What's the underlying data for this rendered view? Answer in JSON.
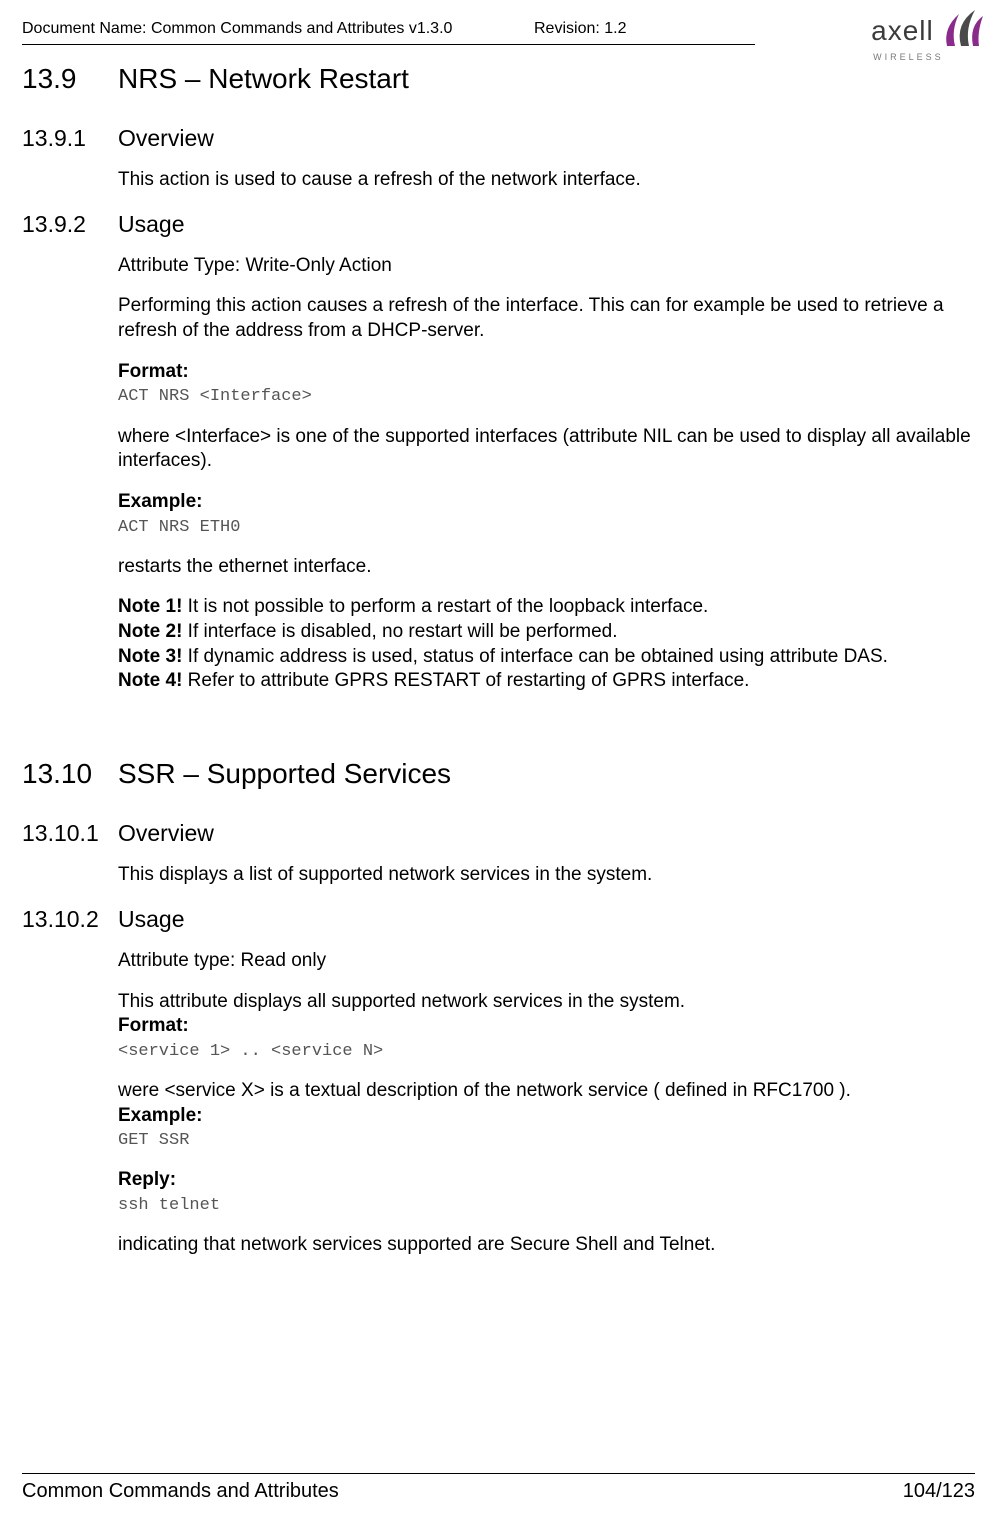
{
  "header": {
    "doc_name": "Document Name: Common Commands and Attributes v1.3.0",
    "revision": "Revision: 1.2",
    "logo_text": "axell",
    "logo_sub": "WIRELESS"
  },
  "section1": {
    "num": "13.9",
    "title": "NRS – Network Restart",
    "sub1": {
      "num": "13.9.1",
      "title": "Overview",
      "p1": "This action is used to cause a refresh of the network interface."
    },
    "sub2": {
      "num": "13.9.2",
      "title": "Usage",
      "attr_type": "Attribute Type: Write-Only Action",
      "p1": "Performing this action causes a refresh of  the interface. This can for example be used to retrieve a refresh of the address from a DHCP-server.",
      "format_label": "Format:",
      "format_code": "ACT NRS <Interface>",
      "p2": "where <Interface> is one of the supported interfaces (attribute NIL can be used to display all available interfaces).",
      "example_label": "Example:",
      "example_code": "ACT NRS ETH0",
      "p3": "restarts the ethernet interface.",
      "note1_label": "Note 1!",
      "note1": " It is not possible to perform a restart of the loopback interface.",
      "note2_label": "Note 2!",
      "note2": " If interface is disabled, no restart will be performed.",
      "note3_label": "Note 3!",
      "note3": " If dynamic address is used, status of interface can be obtained using attribute DAS.",
      "note4_label": "Note 4!",
      "note4": " Refer to attribute GPRS RESTART of restarting of GPRS interface."
    }
  },
  "section2": {
    "num": "13.10",
    "title": "SSR – Supported Services",
    "sub1": {
      "num": "13.10.1",
      "title": "Overview",
      "p1": "This displays a list of supported network services in the system."
    },
    "sub2": {
      "num": "13.10.2",
      "title": "Usage",
      "attr_type": "Attribute type: Read only",
      "p1": "This attribute displays all supported network services in the system.",
      "format_label": "Format:",
      "format_code": "<service 1> .. <service N>",
      "p2": "were <service X> is a textual description of the network service ( defined in RFC1700 ).",
      "example_label": "Example:",
      "example_code": "GET SSR",
      "reply_label": "Reply:",
      "reply_code": "ssh telnet",
      "p3": "indicating that network services supported are Secure Shell and Telnet."
    }
  },
  "footer": {
    "left": "Common Commands and Attributes",
    "right": "104/123"
  }
}
